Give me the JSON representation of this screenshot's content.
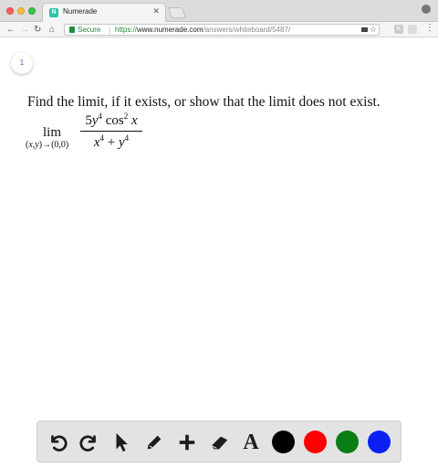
{
  "browser": {
    "tab_title": "Numerade",
    "favicon_letter": "N",
    "secure_label": "Secure",
    "url_scheme": "https://",
    "url_host": "www.numerade.com",
    "url_path": "/answers/whiteboard/5487/",
    "extension_letter": "K"
  },
  "page": {
    "page_number": "1",
    "problem_text": "Find the limit, if it exists, or show that the limit does not exist.",
    "limit": {
      "lim_word": "lim",
      "subscript": "(x,y)→(0,0)",
      "numerator": "5y⁴ cos² x",
      "denominator": "x⁴ + y⁴"
    }
  },
  "whiteboard_toolbar": {
    "tools": [
      "undo-icon",
      "redo-icon",
      "select-pointer-icon",
      "pencil-icon",
      "add-icon",
      "eraser-icon",
      "text-tool-icon"
    ],
    "text_tool_label": "A",
    "colors": [
      "#000000",
      "#ff0000",
      "#0a7d14",
      "#0a20f5"
    ]
  }
}
